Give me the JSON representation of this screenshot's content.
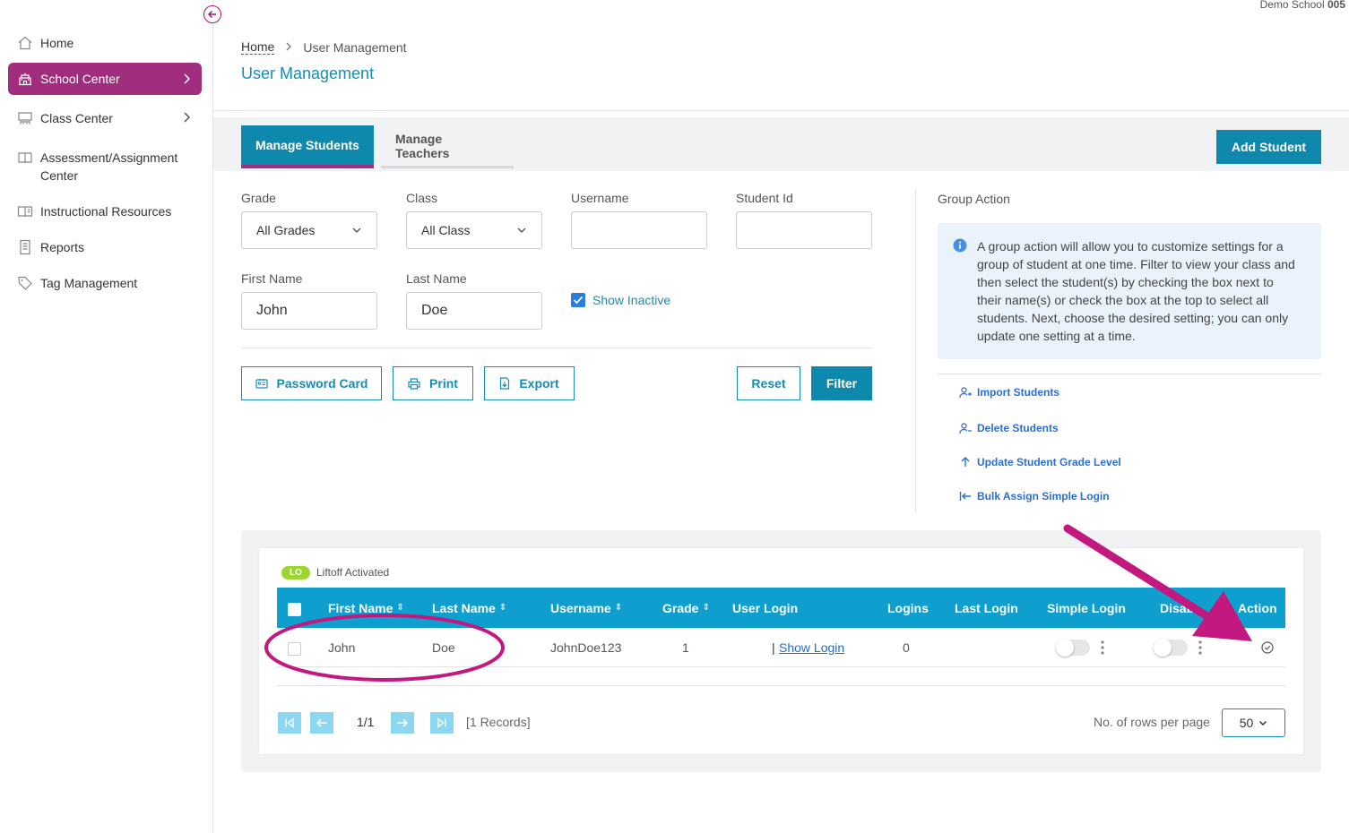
{
  "header": {
    "school_prefix": "Demo School",
    "school_number": "005"
  },
  "sidebar": {
    "items": [
      {
        "label": "Home",
        "icon": "home-icon"
      },
      {
        "label": "School Center",
        "icon": "school-icon",
        "active": true
      },
      {
        "label": "Class Center",
        "icon": "classroom-icon"
      },
      {
        "label": "Assessment/Assignment Center",
        "icon": "book-icon"
      },
      {
        "label": "Instructional Resources",
        "icon": "resources-icon"
      },
      {
        "label": "Reports",
        "icon": "report-icon"
      },
      {
        "label": "Tag Management",
        "icon": "tag-icon"
      }
    ]
  },
  "breadcrumb": {
    "home": "Home",
    "current": "User Management"
  },
  "page_title": "User Management",
  "tabs": {
    "manage_students": "Manage Students",
    "manage_teachers": "Manage Teachers"
  },
  "add_student_label": "Add Student",
  "filters": {
    "grade": {
      "label": "Grade",
      "value": "All Grades"
    },
    "class": {
      "label": "Class",
      "value": "All Class"
    },
    "username": {
      "label": "Username",
      "value": ""
    },
    "student_id": {
      "label": "Student Id",
      "value": ""
    },
    "first_name": {
      "label": "First Name",
      "value": "John"
    },
    "last_name": {
      "label": "Last Name",
      "value": "Doe"
    },
    "show_inactive": {
      "label": "Show Inactive",
      "checked": true
    }
  },
  "buttons": {
    "password_card": "Password Card",
    "print": "Print",
    "export": "Export",
    "reset": "Reset",
    "filter": "Filter"
  },
  "group_action": {
    "title": "Group Action",
    "info_lines": [
      "A group action will allow you to customize settings for a",
      "group of student at one time. Filter to view your class and",
      "then select the student(s) by checking the box next to",
      "their name(s) or check the box at the top to select all",
      "students. Next, choose the desired setting; you can only",
      "update one setting at a time."
    ],
    "links": [
      "Import Students",
      "Delete Students",
      "Update Student Grade Level",
      "Bulk Assign Simple Login"
    ]
  },
  "legend": {
    "badge": "LO",
    "text": "Liftoff Activated"
  },
  "table": {
    "columns": [
      "First Name",
      "Last Name",
      "Username",
      "Grade",
      "User Login",
      "Logins",
      "Last Login",
      "Simple Login",
      "Disab",
      "Action"
    ],
    "rows": [
      {
        "first_name": "John",
        "last_name": "Doe",
        "username": "JohnDoe123",
        "grade": "1",
        "user_login_prefix": "|",
        "user_login_link": "Show Login",
        "logins": "0",
        "last_login": "",
        "simple_login": false,
        "disabled": false
      }
    ]
  },
  "pagination": {
    "page": "1/1",
    "records": "[1 Records]",
    "rows_label": "No. of rows per page",
    "rows_value": "50"
  },
  "colors": {
    "brand_purple": "#a02d7e",
    "brand_teal": "#0f88ad",
    "table_header": "#0f9fcf",
    "annotation_magenta": "#c2187f"
  }
}
